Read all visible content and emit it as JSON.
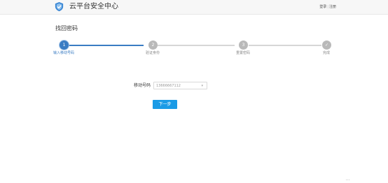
{
  "header": {
    "site_title": "云平台安全中心",
    "login_label": "登录",
    "separator": "|",
    "register_label": "注册",
    "logo_icon": "shield-logo-icon"
  },
  "page": {
    "title": "找回密码"
  },
  "steps": [
    {
      "number": "1",
      "label": "输入移动号码",
      "state": "active"
    },
    {
      "number": "2",
      "label": "验证身份",
      "state": "pending"
    },
    {
      "number": "3",
      "label": "重置密码",
      "state": "pending"
    },
    {
      "number": "✓",
      "label": "完成",
      "state": "pending"
    }
  ],
  "form": {
    "phone_label": "移动号码",
    "phone_value": "13666667112",
    "next_label": "下一步"
  },
  "colors": {
    "accent": "#3a7cc3",
    "button": "#1a9be6",
    "inactive": "#b9b9b9"
  }
}
